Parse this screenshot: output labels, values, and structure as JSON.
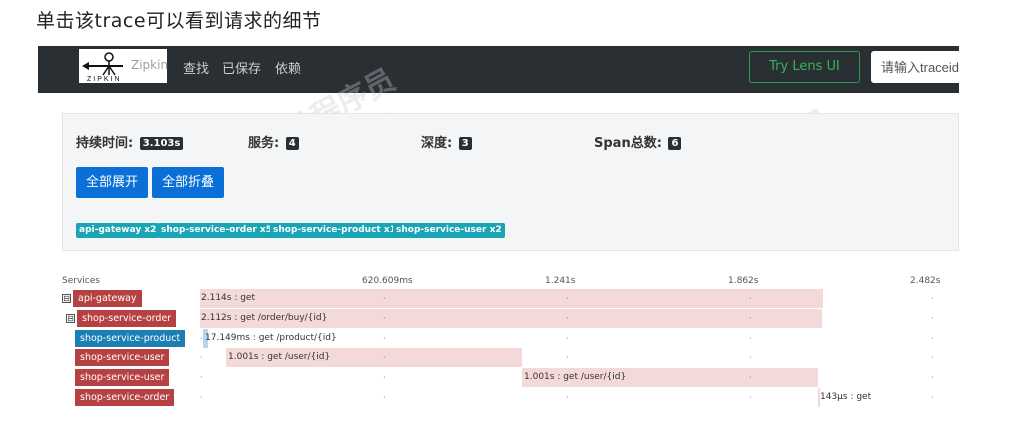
{
  "caption": "单击该trace可以看到请求的细节",
  "navbar": {
    "logo_text": "Zipkin",
    "logo_word": "ZIPKIN",
    "links": [
      "查找",
      "已保存",
      "依赖"
    ],
    "lens_button": "Try Lens UI",
    "search_placeholder": "请输入traceid"
  },
  "summary": {
    "duration_label": "持续时间:",
    "duration_value": "3.103s",
    "services_label": "服务:",
    "services_value": "4",
    "depth_label": "深度:",
    "depth_value": "3",
    "spans_label": "Span总数:",
    "spans_value": "6",
    "expand_all": "全部展开",
    "collapse_all": "全部折叠",
    "service_tags": [
      "api-gateway x2",
      "shop-service-order x5",
      "shop-service-product x1",
      "shop-service-user x2"
    ]
  },
  "timeline": {
    "header": [
      "Services",
      "620.609ms",
      "1.241s",
      "1.862s",
      "2.482s"
    ],
    "rows": [
      {
        "service": "api-gateway",
        "text": "2.114s : get",
        "toggle": "⊟",
        "color": "#b64142"
      },
      {
        "service": "shop-service-order",
        "text": "2.112s : get /order/buy/{id}",
        "toggle": "⊟",
        "color": "#b64142"
      },
      {
        "service": "shop-service-product",
        "text": "17.149ms : get /product/{id}",
        "toggle": "",
        "color": "#1b7fb4"
      },
      {
        "service": "shop-service-user",
        "text": "1.001s : get /user/{id}",
        "toggle": "",
        "color": "#b64142"
      },
      {
        "service": "shop-service-user",
        "text": "1.001s : get /user/{id}",
        "toggle": "",
        "color": "#b64142"
      },
      {
        "service": "shop-service-order",
        "text": "143μs : get",
        "toggle": "",
        "color": "#b64142"
      }
    ]
  },
  "watermark": {
    "brand": "黑马程序员",
    "url": "www.itheima.com"
  }
}
